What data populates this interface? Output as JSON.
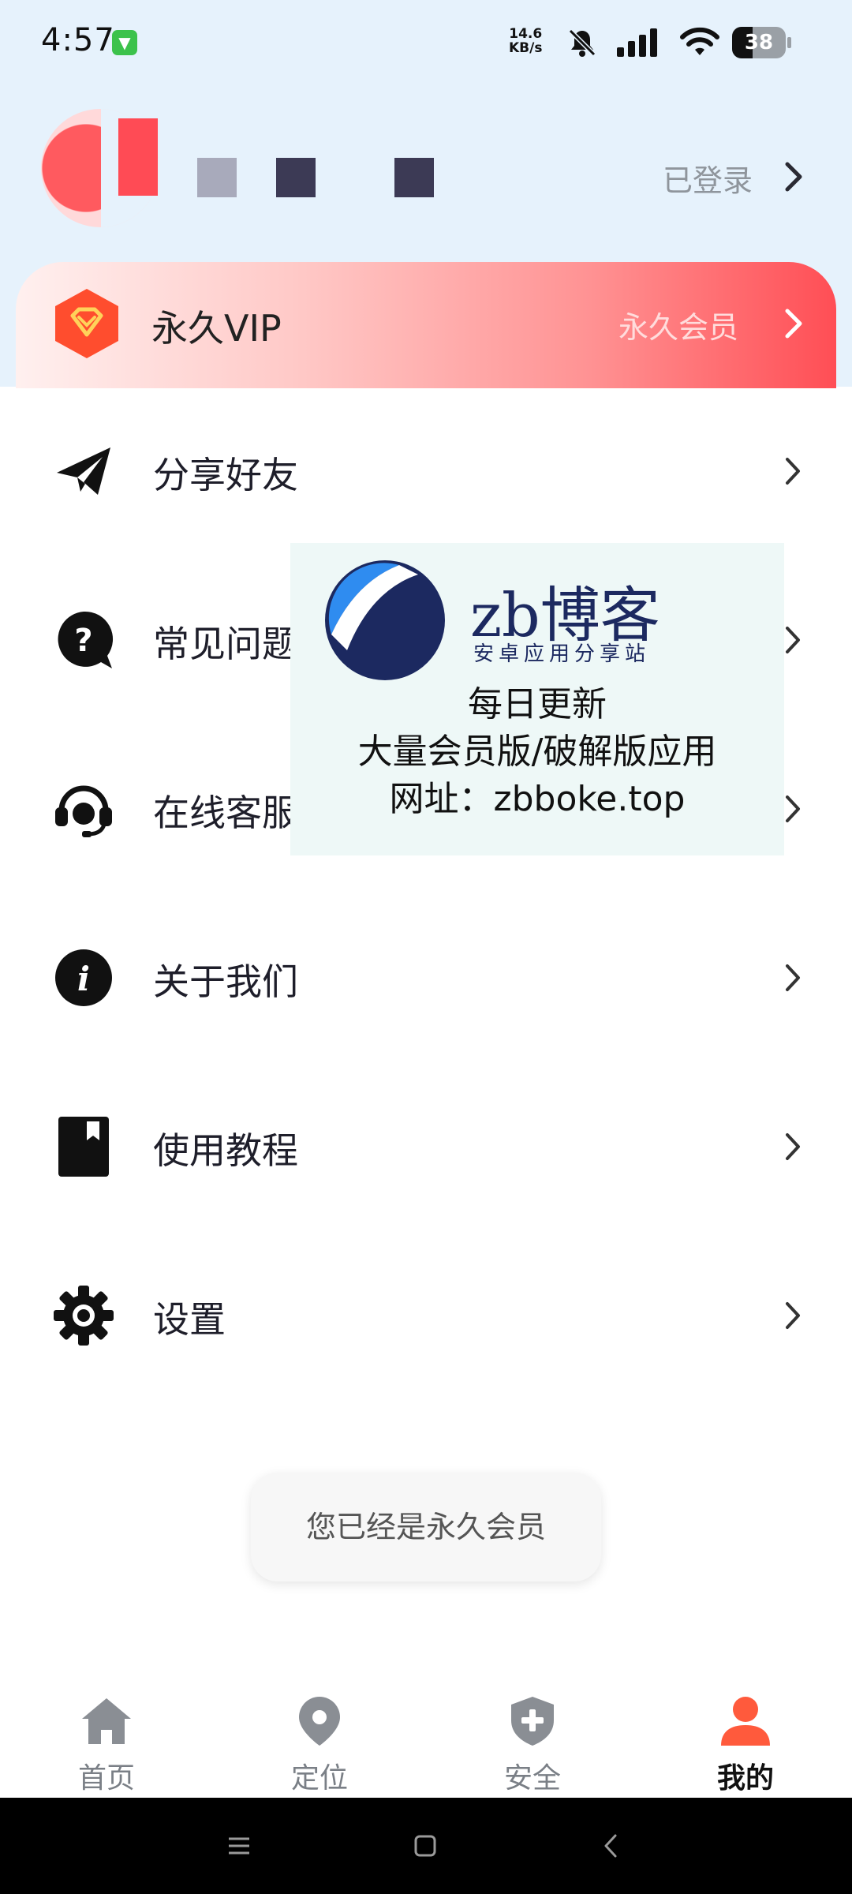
{
  "status_bar": {
    "time": "4:57",
    "speed_value": "14.6",
    "speed_unit": "KB/s",
    "battery": "38",
    "icons": [
      "app-notification-icon",
      "mute-bell-icon",
      "signal-icon",
      "wifi-icon",
      "battery-icon"
    ]
  },
  "profile": {
    "login_status": "已登录"
  },
  "vip": {
    "title": "永久VIP",
    "subtitle": "永久会员",
    "accent": "#ff4e55"
  },
  "menu": {
    "items": [
      {
        "label": "分享好友",
        "icon": "paper-plane-icon"
      },
      {
        "label": "常见问题",
        "icon": "question-icon"
      },
      {
        "label": "在线客服",
        "icon": "headset-icon"
      },
      {
        "label": "关于我们",
        "icon": "info-icon"
      },
      {
        "label": "使用教程",
        "icon": "book-icon"
      },
      {
        "label": "设置",
        "icon": "gear-icon"
      }
    ]
  },
  "watermark": {
    "brand": "zb博客",
    "slogan": "安卓应用分享站",
    "line1": "每日更新",
    "line2": "大量会员版/破解版应用",
    "line3": "网址：zbboke.top"
  },
  "toast": {
    "message": "您已经是永久会员"
  },
  "bottom_nav": {
    "items": [
      {
        "label": "首页",
        "icon": "home-icon",
        "active": false
      },
      {
        "label": "定位",
        "icon": "location-pin-icon",
        "active": false
      },
      {
        "label": "安全",
        "icon": "shield-plus-icon",
        "active": false
      },
      {
        "label": "我的",
        "icon": "user-icon",
        "active": true
      }
    ],
    "active_color": "#ff5a3c"
  }
}
